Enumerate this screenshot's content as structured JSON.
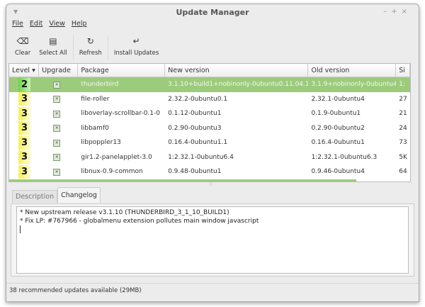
{
  "window": {
    "title": "Update Manager"
  },
  "menu": [
    "File",
    "Edit",
    "View",
    "Help"
  ],
  "toolbar": [
    {
      "label": "Clear",
      "icon": "clear-icon"
    },
    {
      "label": "Select All",
      "icon": "select-all-icon"
    },
    {
      "label": "Refresh",
      "icon": "refresh-icon"
    },
    {
      "label": "Install Updates",
      "icon": "install-icon"
    }
  ],
  "table": {
    "headers": [
      "Level",
      "Upgrade",
      "Package",
      "New version",
      "Old version",
      "Si"
    ],
    "rows": [
      {
        "level": "2",
        "package": "thunderbird",
        "new": "3.1.10+build1+nobinonly-0ubuntu0.11.04.1",
        "old": "3.1.9+nobinonly-0ubuntu4",
        "size": "1:",
        "selected": true
      },
      {
        "level": "3",
        "package": "file-roller",
        "new": "2.32.2-0ubuntu0.1",
        "old": "2.32.1-0ubuntu4",
        "size": "27"
      },
      {
        "level": "3",
        "package": "liboverlay-scrollbar-0.1-0",
        "new": "0.1.12-0ubuntu1",
        "old": "0.1.9-0ubuntu1",
        "size": "21"
      },
      {
        "level": "3",
        "package": "libbamf0",
        "new": "0.2.90-0ubuntu3",
        "old": "0.2.90-0ubuntu2",
        "size": "24"
      },
      {
        "level": "3",
        "package": "libpoppler13",
        "new": "0.16.4-0ubuntu1.1",
        "old": "0.16.4-0ubuntu1",
        "size": "73"
      },
      {
        "level": "3",
        "package": "gir1.2-panelapplet-3.0",
        "new": "1:2.32.1-0ubuntu6.4",
        "old": "1:2.32.1-0ubuntu6.3",
        "size": "5K"
      },
      {
        "level": "3",
        "package": "libnux-0.9-common",
        "new": "0.9.48-0ubuntu1",
        "old": "0.9.46-0ubuntu4",
        "size": "64"
      }
    ]
  },
  "tabs": [
    "Description",
    "Changelog"
  ],
  "changelog": [
    "* New upstream release v3.1.10 (THUNDERBIRD_3_1_10_BUILD1)",
    "* Fix LP: #767966 - globalmenu extension pollutes main window javascript"
  ],
  "status": "38 recommended updates available (29MB)"
}
